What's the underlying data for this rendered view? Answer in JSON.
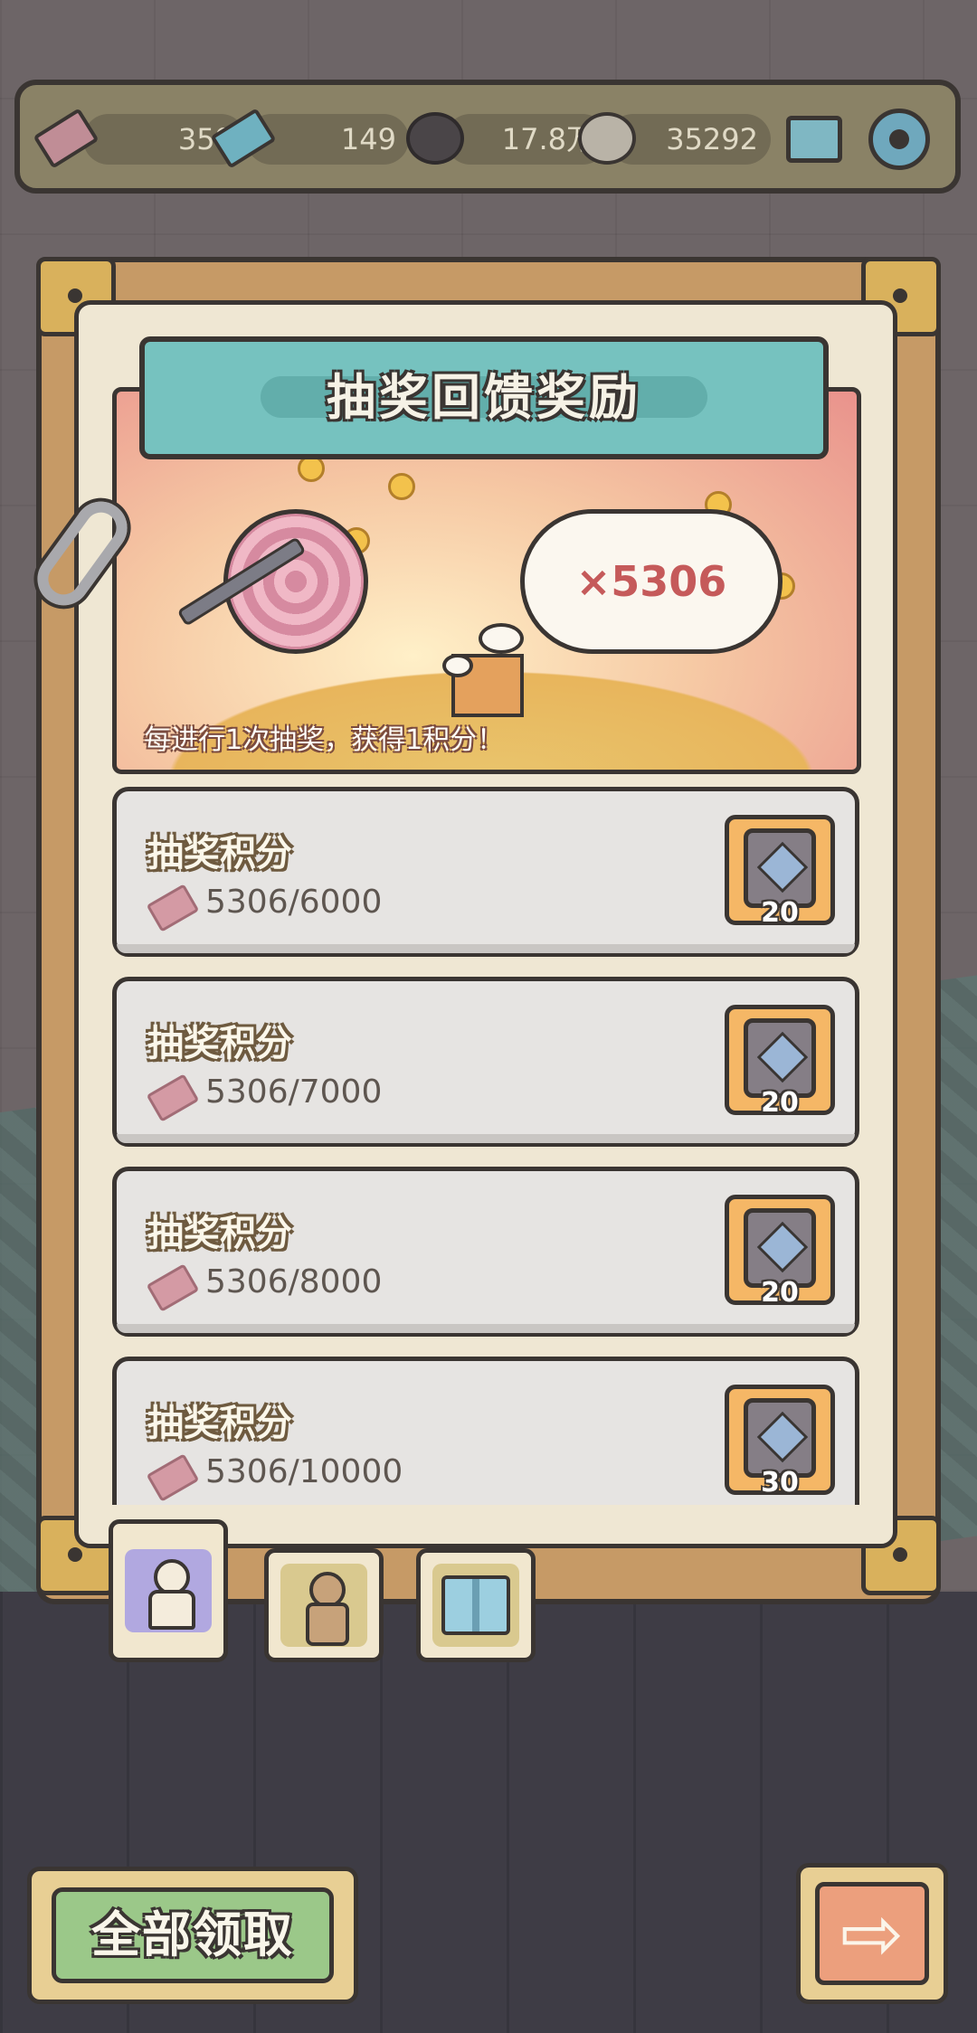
{
  "resources": [
    {
      "name": "pink-ticket",
      "value": "359"
    },
    {
      "name": "blue-ticket",
      "value": "149"
    },
    {
      "name": "dark-soul",
      "value": "17.8万"
    },
    {
      "name": "grey-soul",
      "value": "35292"
    }
  ],
  "panel": {
    "title": "抽奖回馈奖励",
    "points_badge": "×5306",
    "description": "每进行1次抽奖，获得1积分！"
  },
  "rewards": [
    {
      "label": "抽奖积分",
      "progress": "5306/6000",
      "reward_qty": "20",
      "reward_icon": "backpack-icon"
    },
    {
      "label": "抽奖积分",
      "progress": "5306/7000",
      "reward_qty": "20",
      "reward_icon": "backpack-icon"
    },
    {
      "label": "抽奖积分",
      "progress": "5306/8000",
      "reward_qty": "20",
      "reward_icon": "backpack-icon"
    },
    {
      "label": "抽奖积分",
      "progress": "5306/10000",
      "reward_qty": "30",
      "reward_icon": "backpack-icon"
    }
  ],
  "tabs": [
    {
      "icon": "doll-icon",
      "active": true
    },
    {
      "icon": "voodoo-doll-icon",
      "active": false
    },
    {
      "icon": "gift-box-icon",
      "active": false
    }
  ],
  "footer": {
    "claim_all_label": "全部领取",
    "next_icon": "arrow-right-icon",
    "next_glyph": "⇨"
  },
  "colors": {
    "title_plate": "#76c2bf",
    "claim_button": "#9bc889",
    "next_button": "#ec9f7d",
    "reward_slot": "#f5b766",
    "badge_text": "#c55a5a"
  }
}
